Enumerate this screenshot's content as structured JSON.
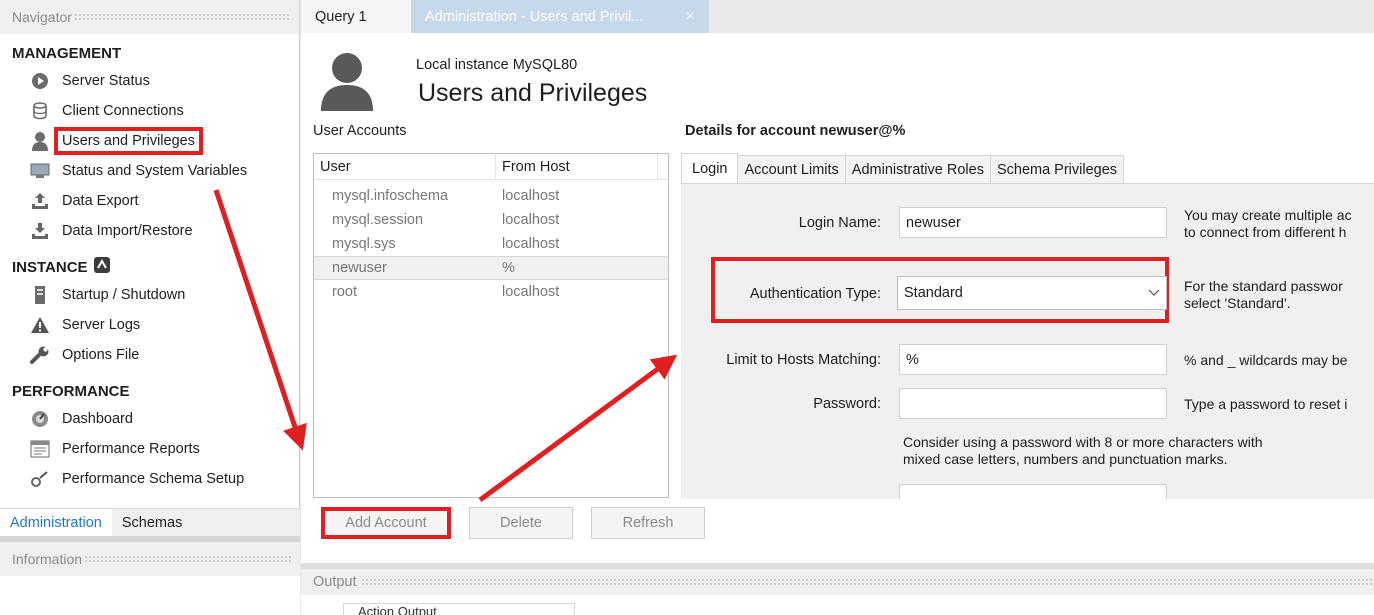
{
  "navigator": {
    "header": "Navigator",
    "management": {
      "title": "MANAGEMENT",
      "items": [
        {
          "label": "Server Status",
          "icon": "play-circle-icon"
        },
        {
          "label": "Client Connections",
          "icon": "database-icon"
        },
        {
          "label": "Users and Privileges",
          "icon": "user-icon"
        },
        {
          "label": "Status and System Variables",
          "icon": "monitor-icon"
        },
        {
          "label": "Data Export",
          "icon": "export-icon"
        },
        {
          "label": "Data Import/Restore",
          "icon": "import-icon"
        }
      ]
    },
    "instance": {
      "title": "INSTANCE",
      "items": [
        {
          "label": "Startup / Shutdown",
          "icon": "server-icon"
        },
        {
          "label": "Server Logs",
          "icon": "warning-icon"
        },
        {
          "label": "Options File",
          "icon": "wrench-icon"
        }
      ]
    },
    "performance": {
      "title": "PERFORMANCE",
      "items": [
        {
          "label": "Dashboard",
          "icon": "dashboard-icon"
        },
        {
          "label": "Performance Reports",
          "icon": "reports-icon"
        },
        {
          "label": "Performance Schema Setup",
          "icon": "schema-setup-icon"
        }
      ]
    },
    "bottom_tabs": {
      "administration": "Administration",
      "schemas": "Schemas"
    },
    "information_header": "Information"
  },
  "tabs": {
    "query": "Query 1",
    "admin": "Administration - Users and Privil...",
    "close": "×"
  },
  "page": {
    "instance": "Local instance MySQL80",
    "title": "Users and Privileges"
  },
  "user_accounts": {
    "label": "User Accounts",
    "columns": {
      "user": "User",
      "host": "From Host"
    },
    "rows": [
      {
        "user": "mysql.infoschema",
        "host": "localhost"
      },
      {
        "user": "mysql.session",
        "host": "localhost"
      },
      {
        "user": "mysql.sys",
        "host": "localhost"
      },
      {
        "user": "newuser",
        "host": "%"
      },
      {
        "user": "root",
        "host": "localhost"
      }
    ],
    "selected": "newuser"
  },
  "buttons": {
    "add": "Add Account",
    "delete": "Delete",
    "refresh": "Refresh"
  },
  "details": {
    "title": "Details for account newuser@%",
    "tabs": [
      "Login",
      "Account Limits",
      "Administrative Roles",
      "Schema Privileges"
    ],
    "login_name_label": "Login Name:",
    "login_name_value": "newuser",
    "login_name_help1": "You may create multiple ac",
    "login_name_help2": "to connect from different h",
    "auth_label": "Authentication Type:",
    "auth_value": "Standard",
    "auth_help1": "For the standard passwor",
    "auth_help2": "select 'Standard'.",
    "hosts_label": "Limit to Hosts Matching:",
    "hosts_value": "%",
    "hosts_help": "% and _ wildcards may be",
    "password_label": "Password:",
    "password_value": "",
    "password_help": "Type a password to reset i",
    "password_hint1": "Consider using a password with 8 or more characters with",
    "password_hint2": "mixed case letters, numbers and punctuation marks."
  },
  "output": {
    "header": "Output",
    "selector": "Action Output"
  },
  "colors": {
    "annotation": "#e02020",
    "link_blue": "#1f78c8",
    "admin_tab": "#c7d8ea"
  }
}
